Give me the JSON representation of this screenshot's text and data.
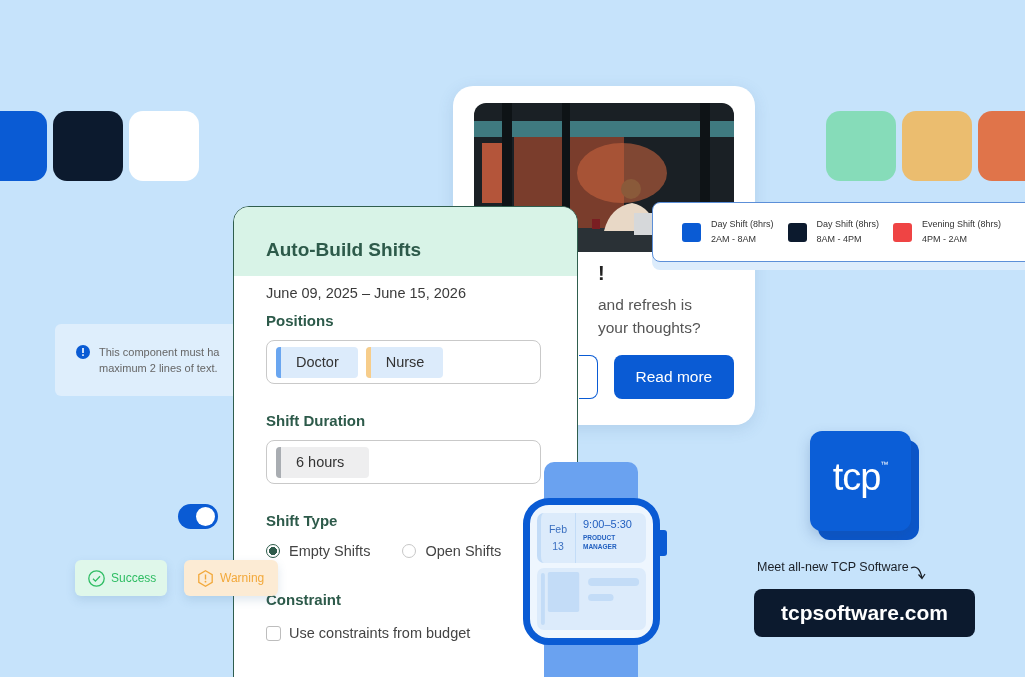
{
  "swatches_left": [
    {
      "color": "#0a5bd4"
    },
    {
      "color": "#0c1a2e"
    },
    {
      "color": "#ffffff"
    }
  ],
  "swatches_right": [
    {
      "color": "#86dcb9"
    },
    {
      "color": "#ebbd6f"
    },
    {
      "color": "#e0744a"
    }
  ],
  "article_card": {
    "picture": {
      "kind": "picture"
    },
    "title": "!",
    "body_lines": [
      "and refresh is",
      "your thoughts?"
    ],
    "buttons": [
      {
        "kind": "outline"
      },
      {
        "kind": "primary",
        "label": "Read more"
      }
    ]
  },
  "shift_legend": [
    {
      "color": "#0a5bd4",
      "name": "Day Shift (8hrs)",
      "time": "2AM - 8AM"
    },
    {
      "color": "#0c1a2e",
      "name": "Day Shift (8hrs)",
      "time": "8AM - 4PM"
    },
    {
      "color": "#ef4444",
      "name": "Evening Shift (8hrs)",
      "time": "4PM - 2AM"
    }
  ],
  "info_banner": {
    "lines": [
      "This component must ha",
      "maximum 2 lines of text."
    ]
  },
  "toggle": {
    "on": true
  },
  "status_badges": [
    {
      "kind": "success",
      "label": "Success"
    },
    {
      "kind": "warning",
      "label": "Warning"
    }
  ],
  "shift_form": {
    "title": "Auto-Build Shifts",
    "date_range": "June 09, 2025 – June 15, 2026",
    "positions": {
      "label": "Positions",
      "chips": [
        {
          "label": "Doctor",
          "color": "#6aa6f0"
        },
        {
          "label": "Nurse",
          "color": "#f7cd8a"
        }
      ]
    },
    "duration": {
      "label": "Shift Duration",
      "chips": [
        {
          "label": "6 hours",
          "color": "#a9adb2"
        }
      ]
    },
    "shift_type": {
      "label": "Shift Type",
      "options": [
        {
          "label": "Empty Shifts",
          "selected": true
        },
        {
          "label": "Open Shifts",
          "selected": false
        }
      ]
    },
    "constraint": {
      "label": "Constraint",
      "options": [
        {
          "label": "Use constraints from budget",
          "checked": false
        }
      ]
    }
  },
  "watch": {
    "month": "Feb",
    "day": "13",
    "time": "9:00–5:30",
    "role": "PRODUCT MANAGER"
  },
  "logo": {
    "text": "tcp",
    "mark": "™"
  },
  "promo": {
    "caption": "Meet all-new TCP Software",
    "url": "tcpsoftware.com"
  }
}
